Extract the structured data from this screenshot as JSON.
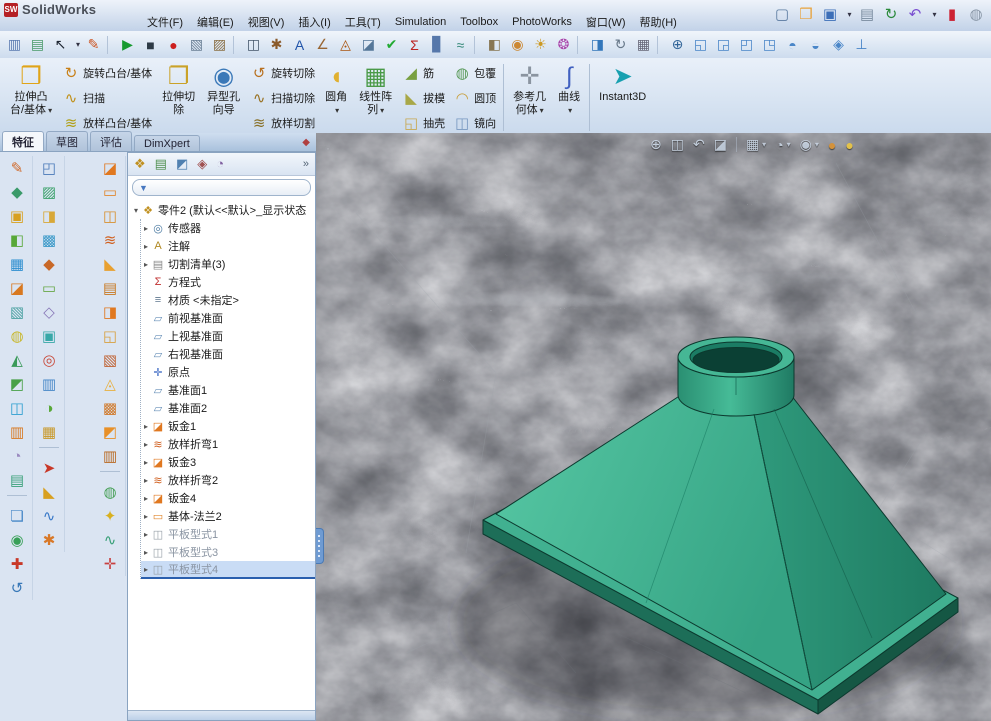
{
  "titlebar": {
    "logo_text": "SW",
    "title": "SolidWorks"
  },
  "ui": {
    "caret": "▾",
    "chevron": "»"
  },
  "theme": {
    "part_color": "#3fae8c",
    "part_dark": "#1e7a61",
    "viewport_bg": "#43464a",
    "accent_blue": "#3a6ea5",
    "selection_bg": "#c9dcf5"
  },
  "menubar": [
    {
      "label": "文件(F)",
      "name": "menu-file"
    },
    {
      "label": "编辑(E)",
      "name": "menu-edit"
    },
    {
      "label": "视图(V)",
      "name": "menu-view"
    },
    {
      "label": "插入(I)",
      "name": "menu-insert"
    },
    {
      "label": "工具(T)",
      "name": "menu-tools"
    },
    {
      "label": "Simulation",
      "name": "menu-simulation"
    },
    {
      "label": "Toolbox",
      "name": "menu-toolbox"
    },
    {
      "label": "PhotoWorks",
      "name": "menu-photoworks"
    },
    {
      "label": "窗口(W)",
      "name": "menu-window"
    },
    {
      "label": "帮助(H)",
      "name": "menu-help"
    }
  ],
  "standard_toolbar": [
    {
      "name": "new-document-icon",
      "g": "▢",
      "c": "#5a7aa0"
    },
    {
      "name": "open-document-icon",
      "g": "❒",
      "c": "#e8a33d"
    },
    {
      "name": "save-icon",
      "g": "▣",
      "c": "#3d6fb8"
    },
    {
      "name": "save-caret",
      "t": "caret",
      "g": "▾",
      "c": "#333344"
    },
    {
      "name": "print-icon",
      "g": "▤",
      "c": "#7a8ca0"
    },
    {
      "name": "rebuild-icon",
      "g": "↻",
      "c": "#2a8a3a"
    },
    {
      "name": "undo-icon",
      "g": "↶",
      "c": "#7a4fd0"
    },
    {
      "name": "undo-caret",
      "t": "caret",
      "g": "▾",
      "c": "#333344"
    },
    {
      "name": "toolbars-toggle-icon",
      "g": "▮",
      "c": "#cc2233"
    },
    {
      "name": "help-icon",
      "g": "◍",
      "c": "#8a98a8"
    }
  ],
  "toolbar2": [
    {
      "name": "print-preview-icon",
      "g": "▥",
      "c": "#5a7ab0"
    },
    {
      "name": "page-setup-icon",
      "g": "▤",
      "c": "#4a9a6a"
    },
    {
      "name": "select-arrow-icon",
      "g": "↖",
      "c": "#1c2430"
    },
    {
      "name": "select-caret",
      "t": "caret",
      "g": "▾",
      "c": "#333344"
    },
    {
      "name": "sketch-pencil-icon",
      "g": "✎",
      "c": "#cc5522"
    },
    {
      "name": "toolbar-separator",
      "t": "sep"
    },
    {
      "name": "run-macro-icon",
      "g": "▶",
      "c": "#169a2f"
    },
    {
      "name": "stop-macro-icon",
      "g": "■",
      "c": "#2e3a46"
    },
    {
      "name": "record-macro-icon",
      "g": "●",
      "c": "#cc1f1f"
    },
    {
      "name": "new-macro-icon",
      "g": "▧",
      "c": "#6a7f95"
    },
    {
      "name": "edit-macro-icon",
      "g": "▨",
      "c": "#8a6f45"
    },
    {
      "name": "toolbar-separator",
      "t": "sep"
    },
    {
      "name": "screen-capture-icon",
      "g": "◫",
      "c": "#44566a"
    },
    {
      "name": "options-icon",
      "g": "✱",
      "c": "#8a5a2a"
    },
    {
      "name": "spell-check-icon",
      "g": "A",
      "c": "#2255aa"
    },
    {
      "name": "measure-icon",
      "g": "∠",
      "c": "#996633"
    },
    {
      "name": "mass-properties-icon",
      "g": "◬",
      "c": "#aa5511"
    },
    {
      "name": "section-properties-icon",
      "g": "◪",
      "c": "#557799"
    },
    {
      "name": "check-entity-icon",
      "g": "✔",
      "c": "#22aa33"
    },
    {
      "name": "equations-icon",
      "g": "Σ",
      "c": "#bb2222"
    },
    {
      "name": "statistics-icon",
      "g": "▊",
      "c": "#5577aa"
    },
    {
      "name": "deviation-analysis-icon",
      "g": "≈",
      "c": "#338877"
    },
    {
      "name": "toolbar-separator",
      "t": "sep"
    },
    {
      "name": "edit-material-icon",
      "g": "◧",
      "c": "#887755"
    },
    {
      "name": "edit-appearance-icon",
      "g": "◉",
      "c": "#cc8833"
    },
    {
      "name": "edit-scene-icon",
      "g": "☀",
      "c": "#cc9922"
    },
    {
      "name": "render-icon",
      "g": "❂",
      "c": "#aa44aa"
    },
    {
      "name": "toolbar-separator",
      "t": "sep"
    },
    {
      "name": "simulation-advisor-icon",
      "g": "◨",
      "c": "#3377bb"
    },
    {
      "name": "motion-study-icon",
      "g": "↻",
      "c": "#667788"
    },
    {
      "name": "toolbox-icon",
      "g": "▦",
      "c": "#666677"
    },
    {
      "name": "toolbar-separator",
      "t": "sep"
    },
    {
      "name": "zoom-to-fit-icon",
      "g": "⊕",
      "c": "#336699"
    },
    {
      "name": "front-view-icon",
      "g": "◱",
      "c": "#4a86c8"
    },
    {
      "name": "back-view-icon",
      "g": "◲",
      "c": "#4a86c8"
    },
    {
      "name": "left-view-icon",
      "g": "◰",
      "c": "#4a86c8"
    },
    {
      "name": "right-view-icon",
      "g": "◳",
      "c": "#4a86c8"
    },
    {
      "name": "top-view-icon",
      "g": "◓",
      "c": "#4a86c8"
    },
    {
      "name": "bottom-view-icon",
      "g": "◒",
      "c": "#4a86c8"
    },
    {
      "name": "isometric-view-icon",
      "g": "◈",
      "c": "#4a86c8"
    },
    {
      "name": "normal-to-icon",
      "g": "⊥",
      "c": "#4a86c8"
    }
  ],
  "ribbon": {
    "big1": {
      "label1": "拉伸凸",
      "label2": "台/基体",
      "glyph": "❒",
      "color": "#e0a418",
      "caret": true
    },
    "stack1": [
      {
        "name": "revolve-boss-button",
        "label": "旋转凸台/基体",
        "glyph": "↻",
        "color": "#c88018"
      },
      {
        "name": "swept-boss-button",
        "label": "扫描",
        "glyph": "∿",
        "color": "#c09018"
      },
      {
        "name": "lofted-boss-button",
        "label": "放样凸台/基体",
        "glyph": "≋",
        "color": "#b0a018"
      }
    ],
    "big2": {
      "label1": "拉伸切",
      "label2": "除",
      "glyph": "❐",
      "color": "#caa228"
    },
    "big3": {
      "label1": "异型孔",
      "label2": "向导",
      "glyph": "◉",
      "color": "#3a78b8"
    },
    "stack2": [
      {
        "name": "revolved-cut-button",
        "label": "旋转切除",
        "glyph": "↺",
        "color": "#b87020"
      },
      {
        "name": "swept-cut-button",
        "label": "扫描切除",
        "glyph": "∿",
        "color": "#987020"
      },
      {
        "name": "lofted-cut-button",
        "label": "放样切割",
        "glyph": "≋",
        "color": "#887028"
      }
    ],
    "big4": {
      "label1": "圆角",
      "label2": "",
      "glyph": "◖",
      "color": "#e0b030",
      "caret": true
    },
    "big5": {
      "label1": "线性阵",
      "label2": "列",
      "glyph": "▦",
      "color": "#4a9a48",
      "caret": true
    },
    "stack3": [
      {
        "name": "rib-button",
        "label": "筋",
        "glyph": "◢",
        "color": "#78a040"
      },
      {
        "name": "draft-button",
        "label": "拔模",
        "glyph": "◣",
        "color": "#a8a848"
      },
      {
        "name": "shell-button",
        "label": "抽壳",
        "glyph": "◱",
        "color": "#c8a850"
      }
    ],
    "stack4": [
      {
        "name": "wrap-button",
        "label": "包覆",
        "glyph": "◍",
        "color": "#5a9a5a"
      },
      {
        "name": "dome-button",
        "label": "圆顶",
        "glyph": "◠",
        "color": "#c8a040"
      },
      {
        "name": "mirror-button",
        "label": "镜向",
        "glyph": "◫",
        "color": "#7898c0"
      }
    ],
    "big6": {
      "label1": "参考几",
      "label2": "何体",
      "glyph": "✛",
      "color": "#8a94a0",
      "caret": true
    },
    "big7": {
      "label1": "曲线",
      "label2": "",
      "glyph": "∫",
      "color": "#4060c0",
      "caret": true
    },
    "big8": {
      "label1": "Instant3D",
      "label2": "",
      "glyph": "➤",
      "color": "#18a0b0"
    }
  },
  "tabs": [
    {
      "label": "特征",
      "name": "tab-features",
      "state": "active"
    },
    {
      "label": "草图",
      "name": "tab-sketch",
      "state": ""
    },
    {
      "label": "评估",
      "name": "tab-evaluate",
      "state": ""
    },
    {
      "label": "DimXpert",
      "name": "tab-dimxpert",
      "state": ""
    }
  ],
  "tabrow_icon": {
    "g": "◆",
    "c": "#b04040"
  },
  "left_toolbars": {
    "col1": [
      {
        "name": "sketch-tool-icon",
        "g": "✎",
        "c": "#d06828"
      },
      {
        "name": "smart-dimension-icon",
        "g": "◆",
        "c": "#3a9a6a"
      },
      {
        "g": "▣",
        "c": "#d8a020"
      },
      {
        "g": "◧",
        "c": "#58a838"
      },
      {
        "g": "▦",
        "c": "#2f8fd0"
      },
      {
        "g": "◪",
        "c": "#d87820"
      },
      {
        "g": "▧",
        "c": "#49a0a0"
      },
      {
        "g": "◍",
        "c": "#c8b830"
      },
      {
        "g": "◭",
        "c": "#3a9a5a"
      },
      {
        "g": "◩",
        "c": "#48a048"
      },
      {
        "g": "◫",
        "c": "#2f9fd0"
      },
      {
        "g": "▥",
        "c": "#d87820"
      },
      {
        "g": "◔",
        "c": "#9a8ac0"
      },
      {
        "g": "▤",
        "c": "#3aa07a"
      },
      {
        "t": "sep"
      },
      {
        "name": "3d-sketch-icon",
        "g": "❏",
        "c": "#4888c8"
      },
      {
        "g": "◉",
        "c": "#38a058"
      },
      {
        "g": "✚",
        "c": "#c83828"
      },
      {
        "g": "↺",
        "c": "#3878b8"
      }
    ],
    "col2": [
      {
        "g": "◰",
        "c": "#4878b8"
      },
      {
        "g": "▨",
        "c": "#38a068"
      },
      {
        "g": "◨",
        "c": "#d8a838"
      },
      {
        "g": "▩",
        "c": "#3898c8"
      },
      {
        "g": "◆",
        "c": "#c86828"
      },
      {
        "g": "▭",
        "c": "#68a848"
      },
      {
        "g": "◇",
        "c": "#8878b8"
      },
      {
        "g": "▣",
        "c": "#38a8a8"
      },
      {
        "g": "◎",
        "c": "#c84838"
      },
      {
        "g": "▥",
        "c": "#4888c8"
      },
      {
        "g": "◑",
        "c": "#58a838"
      },
      {
        "g": "▦",
        "c": "#c89828"
      },
      {
        "t": "sep"
      },
      {
        "g": "➤",
        "c": "#c83828"
      },
      {
        "g": "◣",
        "c": "#d8a020"
      },
      {
        "g": "∿",
        "c": "#3878c8"
      },
      {
        "g": "✱",
        "c": "#d87828"
      }
    ],
    "col3": [
      {
        "name": "sheet-metal-flange-icon",
        "g": "◪",
        "c": "#e07820"
      },
      {
        "g": "▭",
        "c": "#e08830"
      },
      {
        "g": "◫",
        "c": "#d89030"
      },
      {
        "g": "≋",
        "c": "#d06020"
      },
      {
        "g": "◣",
        "c": "#e8a030"
      },
      {
        "g": "▤",
        "c": "#c87820"
      },
      {
        "g": "◨",
        "c": "#e07820"
      },
      {
        "g": "◱",
        "c": "#d8a040"
      },
      {
        "g": "▧",
        "c": "#c06030"
      },
      {
        "g": "◬",
        "c": "#e8b040"
      },
      {
        "g": "▩",
        "c": "#d07828"
      },
      {
        "g": "◩",
        "c": "#e89028"
      },
      {
        "g": "▥",
        "c": "#b86820"
      },
      {
        "t": "sep"
      },
      {
        "g": "◍",
        "c": "#48a058"
      },
      {
        "g": "✦",
        "c": "#d8b020"
      },
      {
        "g": "∿",
        "c": "#38a078"
      },
      {
        "g": "✛",
        "c": "#c84040"
      }
    ]
  },
  "feature_panel": {
    "tabs": [
      {
        "name": "featuremanager-tree-tab",
        "g": "❖",
        "c": "#c09020"
      },
      {
        "name": "propertymanager-tab",
        "g": "▤",
        "c": "#509050"
      },
      {
        "name": "configurationmanager-tab",
        "g": "◩",
        "c": "#5080b0"
      },
      {
        "name": "dimxpertmanager-tab",
        "g": "◈",
        "c": "#a05050"
      },
      {
        "name": "displaymanager-tab",
        "g": "◔",
        "c": "#8060a0"
      }
    ],
    "root": {
      "label": "零件2 (默认<<默认>_显示状态",
      "glyph": "❖",
      "color": "#c09020",
      "arrow": "▾"
    },
    "items": [
      {
        "name": "tree-item-sensors",
        "label": "传感器",
        "glyph": "◎",
        "color": "#4878a0",
        "arrow": "▸"
      },
      {
        "name": "tree-item-annotations",
        "label": "注解",
        "glyph": "A",
        "color": "#b08820",
        "arrow": "▸"
      },
      {
        "name": "tree-item-cut-list",
        "label": "切割清单(3)",
        "glyph": "▤",
        "color": "#888888",
        "arrow": "▸"
      },
      {
        "name": "tree-item-equations",
        "label": "方程式",
        "glyph": "Σ",
        "color": "#c03030",
        "arrow": ""
      },
      {
        "name": "tree-item-material",
        "label": "材质 <未指定>",
        "glyph": "≡",
        "color": "#607890",
        "arrow": ""
      },
      {
        "name": "tree-item-front-plane",
        "label": "前视基准面",
        "glyph": "▱",
        "color": "#6890b8",
        "arrow": ""
      },
      {
        "name": "tree-item-top-plane",
        "label": "上视基准面",
        "glyph": "▱",
        "color": "#6890b8",
        "arrow": ""
      },
      {
        "name": "tree-item-right-plane",
        "label": "右视基准面",
        "glyph": "▱",
        "color": "#6890b8",
        "arrow": ""
      },
      {
        "name": "tree-item-origin",
        "label": "原点",
        "glyph": "✛",
        "color": "#3060c0",
        "arrow": ""
      },
      {
        "name": "tree-item-plane1",
        "label": "基准面1",
        "glyph": "▱",
        "color": "#6890b8",
        "arrow": ""
      },
      {
        "name": "tree-item-plane2",
        "label": "基准面2",
        "glyph": "▱",
        "color": "#6890b8",
        "arrow": ""
      },
      {
        "name": "tree-item-sheet-metal1",
        "label": "钣金1",
        "glyph": "◪",
        "color": "#e07820",
        "arrow": "▸"
      },
      {
        "name": "tree-item-lofted-bend1",
        "label": "放样折弯1",
        "glyph": "≋",
        "color": "#d06020",
        "arrow": "▸"
      },
      {
        "name": "tree-item-sheet-metal3",
        "label": "钣金3",
        "glyph": "◪",
        "color": "#e07820",
        "arrow": "▸"
      },
      {
        "name": "tree-item-lofted-bend2",
        "label": "放样折弯2",
        "glyph": "≋",
        "color": "#d06020",
        "arrow": "▸"
      },
      {
        "name": "tree-item-sheet-metal4",
        "label": "钣金4",
        "glyph": "◪",
        "color": "#e07820",
        "arrow": "▸"
      },
      {
        "name": "tree-item-base-flange2",
        "label": "基体-法兰2",
        "glyph": "▭",
        "color": "#e08830",
        "arrow": "▸"
      },
      {
        "name": "tree-item-flat-pattern1",
        "label": "平板型式1",
        "glyph": "◫",
        "color": "#98a0a8",
        "arrow": "▸",
        "state": "muted"
      },
      {
        "name": "tree-item-flat-pattern3",
        "label": "平板型式3",
        "glyph": "◫",
        "color": "#98a0a8",
        "arrow": "▸",
        "state": "muted"
      },
      {
        "name": "tree-item-flat-pattern4",
        "label": "平板型式4",
        "glyph": "◫",
        "color": "#98a0a8",
        "arrow": "▸",
        "state": "muted selected"
      }
    ]
  },
  "hud": [
    {
      "name": "zoom-to-fit-icon",
      "g": "⊕"
    },
    {
      "name": "zoom-to-area-icon",
      "g": "◫"
    },
    {
      "name": "previous-view-icon",
      "g": "↶"
    },
    {
      "name": "section-view-icon",
      "g": "◪"
    },
    {
      "name": "hud-separator",
      "t": "sep"
    },
    {
      "name": "view-orientation-icon",
      "g": "▦"
    },
    {
      "name": "view-orientation-caret",
      "t": "caret",
      "g": "▾"
    },
    {
      "name": "display-style-icon",
      "g": "◔"
    },
    {
      "name": "display-style-caret",
      "t": "caret",
      "g": "▾"
    },
    {
      "name": "hide-show-items-icon",
      "g": "◉"
    },
    {
      "name": "hide-show-caret",
      "t": "caret",
      "g": "▾"
    },
    {
      "name": "edit-appearance-icon",
      "g": "●",
      "c": "#d4923a"
    },
    {
      "name": "apply-scene-icon",
      "g": "●",
      "c": "#e3c24a"
    }
  ]
}
